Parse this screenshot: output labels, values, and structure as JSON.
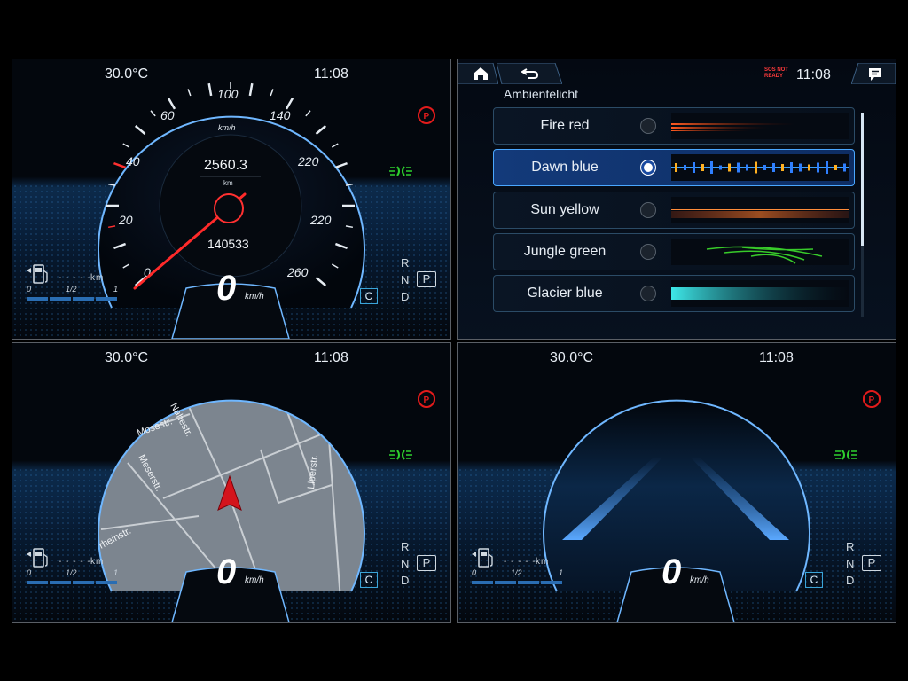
{
  "panels": {
    "speedometer": {
      "temperature": "30.0°C",
      "time": "11:08",
      "speed_unit": "km/h",
      "trip_distance": "2560.3",
      "trip_unit": "km",
      "odometer": "140533",
      "speed": "0",
      "speed_label_unit": "km/h",
      "scale_labels": [
        "0",
        "20",
        "40",
        "60",
        "100",
        "140",
        "220",
        "220",
        "260"
      ],
      "fuel": {
        "range": "- - - - -",
        "unit": "km",
        "scale": [
          "0",
          "1/2",
          "1"
        ]
      },
      "gears": [
        "R",
        "N",
        "P",
        "D"
      ],
      "drive_mode": "C"
    },
    "ambient": {
      "status_top": "SOS NOT",
      "status_bottom": "READY",
      "time": "11:08",
      "section_title": "Ambientelicht",
      "items": [
        {
          "label": "Fire red"
        },
        {
          "label": "Dawn blue",
          "selected": true
        },
        {
          "label": "Sun yellow"
        },
        {
          "label": "Jungle green"
        },
        {
          "label": "Glacier blue"
        }
      ]
    },
    "navigation": {
      "temperature": "30.0°C",
      "time": "11:08",
      "streets": [
        "Nahestr.",
        "Mosestr.",
        "Meserstr.",
        "Liperstr.",
        "rheinstr."
      ],
      "speed": "0",
      "speed_unit": "km/h",
      "fuel": {
        "range": "- - - - -",
        "unit": "km",
        "scale": [
          "0",
          "1/2",
          "1"
        ]
      },
      "gears": [
        "R",
        "N",
        "P",
        "D"
      ],
      "drive_mode": "C"
    },
    "assist": {
      "temperature": "30.0°C",
      "time": "11:08",
      "speed": "0",
      "speed_unit": "km/h",
      "fuel": {
        "range": "- - - - -",
        "unit": "km",
        "scale": [
          "0",
          "1/2",
          "1"
        ]
      },
      "gears": [
        "R",
        "N",
        "P",
        "D"
      ],
      "drive_mode": "C"
    }
  },
  "colors": {
    "accent_blue": "#2a6db2",
    "needle_red": "#ff2a2a",
    "park_red": "#e11b1b",
    "light_green": "#2ed12e"
  }
}
